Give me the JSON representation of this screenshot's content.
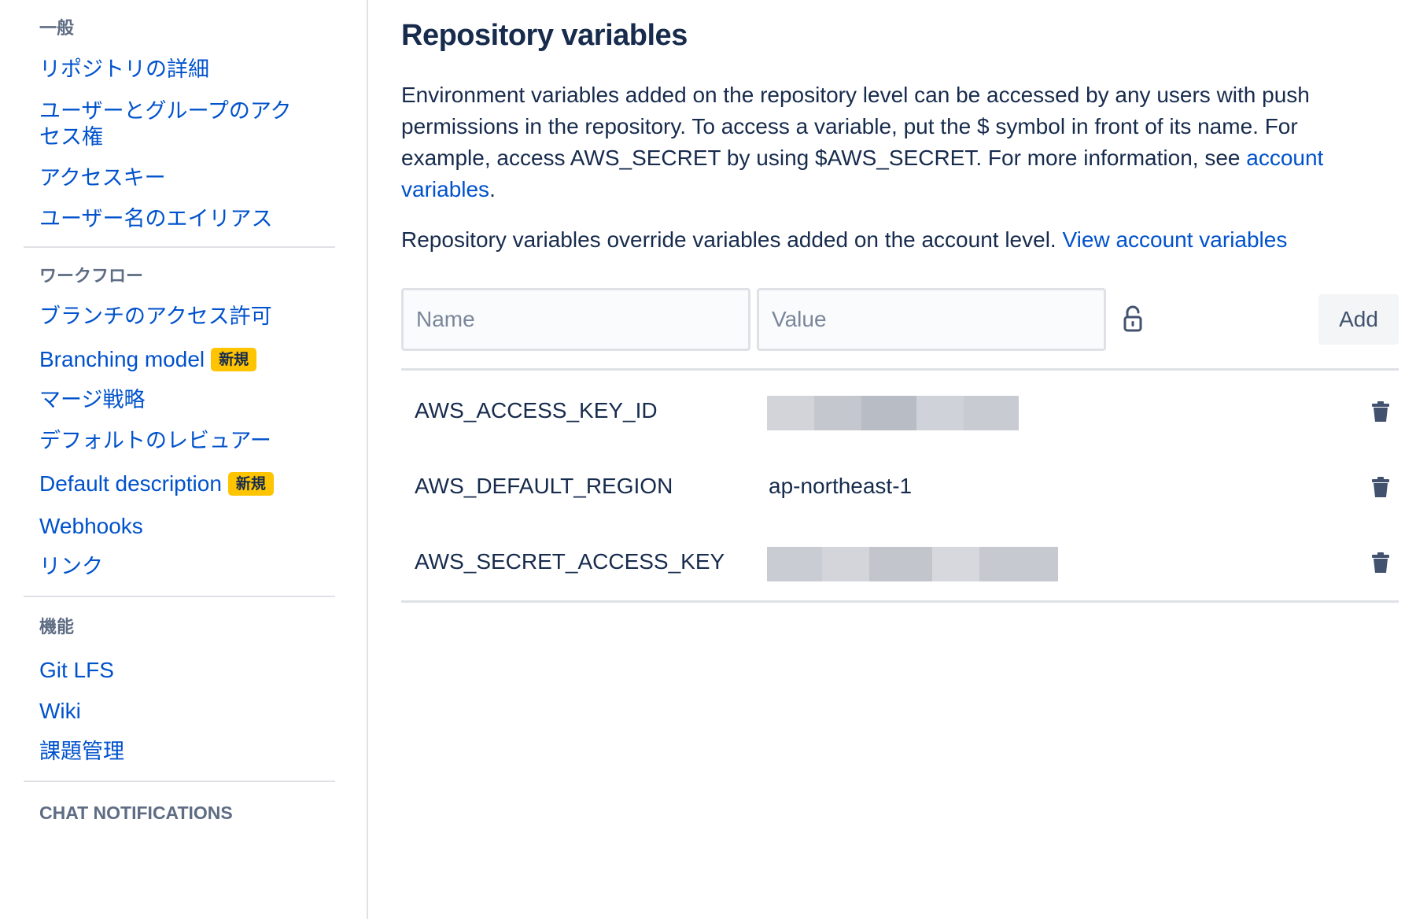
{
  "sidebar": {
    "sections": [
      {
        "heading": "一般",
        "items": [
          {
            "label": "リポジトリの詳細"
          },
          {
            "label": "ユーザーとグループのアク"
          },
          {
            "label": "セス権"
          },
          {
            "label": "アクセスキー"
          },
          {
            "label": "ユーザー名のエイリアス"
          }
        ]
      },
      {
        "heading": "ワークフロー",
        "items": [
          {
            "label": "ブランチのアクセス許可"
          },
          {
            "label": "Branching model",
            "badge": "新規"
          },
          {
            "label": "マージ戦略"
          },
          {
            "label": "デフォルトのレビュアー"
          },
          {
            "label": "Default description",
            "badge": "新規"
          },
          {
            "label": "Webhooks"
          },
          {
            "label": "リンク"
          }
        ]
      },
      {
        "heading": "機能",
        "items": [
          {
            "label": "Git LFS"
          },
          {
            "label": "Wiki"
          },
          {
            "label": "課題管理"
          }
        ]
      },
      {
        "heading": "CHAT NOTIFICATIONS"
      }
    ]
  },
  "main": {
    "title": "Repository variables",
    "description": {
      "text": "Environment variables added on the repository level can be accessed by any users with push permissions in the repository. To access a variable, put the $ symbol in front of its name. For example, access AWS_SECRET by using $AWS_SECRET. For more information, see ",
      "link": "account variables",
      "after": "."
    },
    "override": {
      "text": "Repository variables override variables added on the account level. ",
      "link": "View account variables"
    },
    "form": {
      "name_placeholder": "Name",
      "value_placeholder": "Value",
      "lock_icon": "unlocked-padlock-icon",
      "add_label": "Add"
    },
    "variables": [
      {
        "name": "AWS_ACCESS_KEY_ID",
        "value": "",
        "masked": true
      },
      {
        "name": "AWS_DEFAULT_REGION",
        "value": "ap-northeast-1",
        "masked": false
      },
      {
        "name": "AWS_SECRET_ACCESS_KEY",
        "value": "",
        "masked": true
      }
    ],
    "delete_icon": "trash-icon"
  },
  "colors": {
    "link": "#0052cc",
    "text": "#172b4d",
    "muted": "#5e6c84",
    "border": "#dfe1e6",
    "badge": "#ffc400"
  }
}
